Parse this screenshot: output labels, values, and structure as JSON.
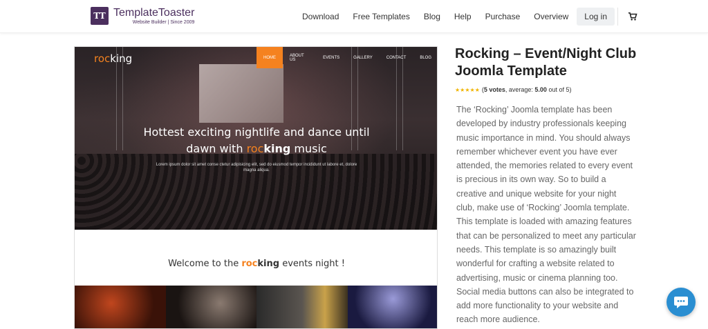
{
  "header": {
    "logo_mark": "TT",
    "logo_name": "TemplateToaster",
    "logo_tagline": "Website Builder | Since 2009",
    "nav": [
      "Download",
      "Free Templates",
      "Blog",
      "Help",
      "Purchase",
      "Overview"
    ],
    "login_label": "Log in",
    "cart_icon": "cart-icon"
  },
  "preview": {
    "logo_roc": "roc",
    "logo_king": "king",
    "nav": [
      "HOME",
      "ABOUT US",
      "EVENTS",
      "GALLERY",
      "CONTACT",
      "BLOG"
    ],
    "active_nav": "HOME",
    "hero_line1": "Hottest exciting nightlife and dance until",
    "hero_line2_pre": "dawn with ",
    "hero_line2_roc": "roc",
    "hero_line2_king": "king",
    "hero_line2_post": " music",
    "hero_sub": "Lorem ipsum dolor sit amet conse ctetur adipisicing elit, sed do eiusmod tempor incididunt ut labore et, dolore magna aliqua.",
    "welcome_pre": "Welcome to the ",
    "welcome_roc": "roc",
    "welcome_king": "king",
    "welcome_post": " events night !",
    "accent_color": "#f5821f"
  },
  "info": {
    "title": "Rocking – Event/Night Club Joomla Template",
    "rating_stars": 5,
    "votes_text_pre": "(",
    "votes_count": "5 votes",
    "votes_mid": ", average: ",
    "average": "5.00",
    "votes_post": " out of 5)",
    "description": "The ‘Rocking’ Joomla template has been developed by industry professionals keeping music importance in mind. You should always remember whichever event you have ever attended, the memories related to every event is precious in its own way. So to build a creative and unique website for your night club, make use of ‘Rocking’ Joomla template. This template is loaded with amazing features that can be personalized to meet any particular needs. This template is so amazingly built wonderful for crafting a website related to advertising, music or cinema planning too. Social media buttons can also be integrated to add more functionality to your website and reach more audience."
  },
  "chat": {
    "icon": "chat-icon",
    "color": "#2a8ed1"
  }
}
